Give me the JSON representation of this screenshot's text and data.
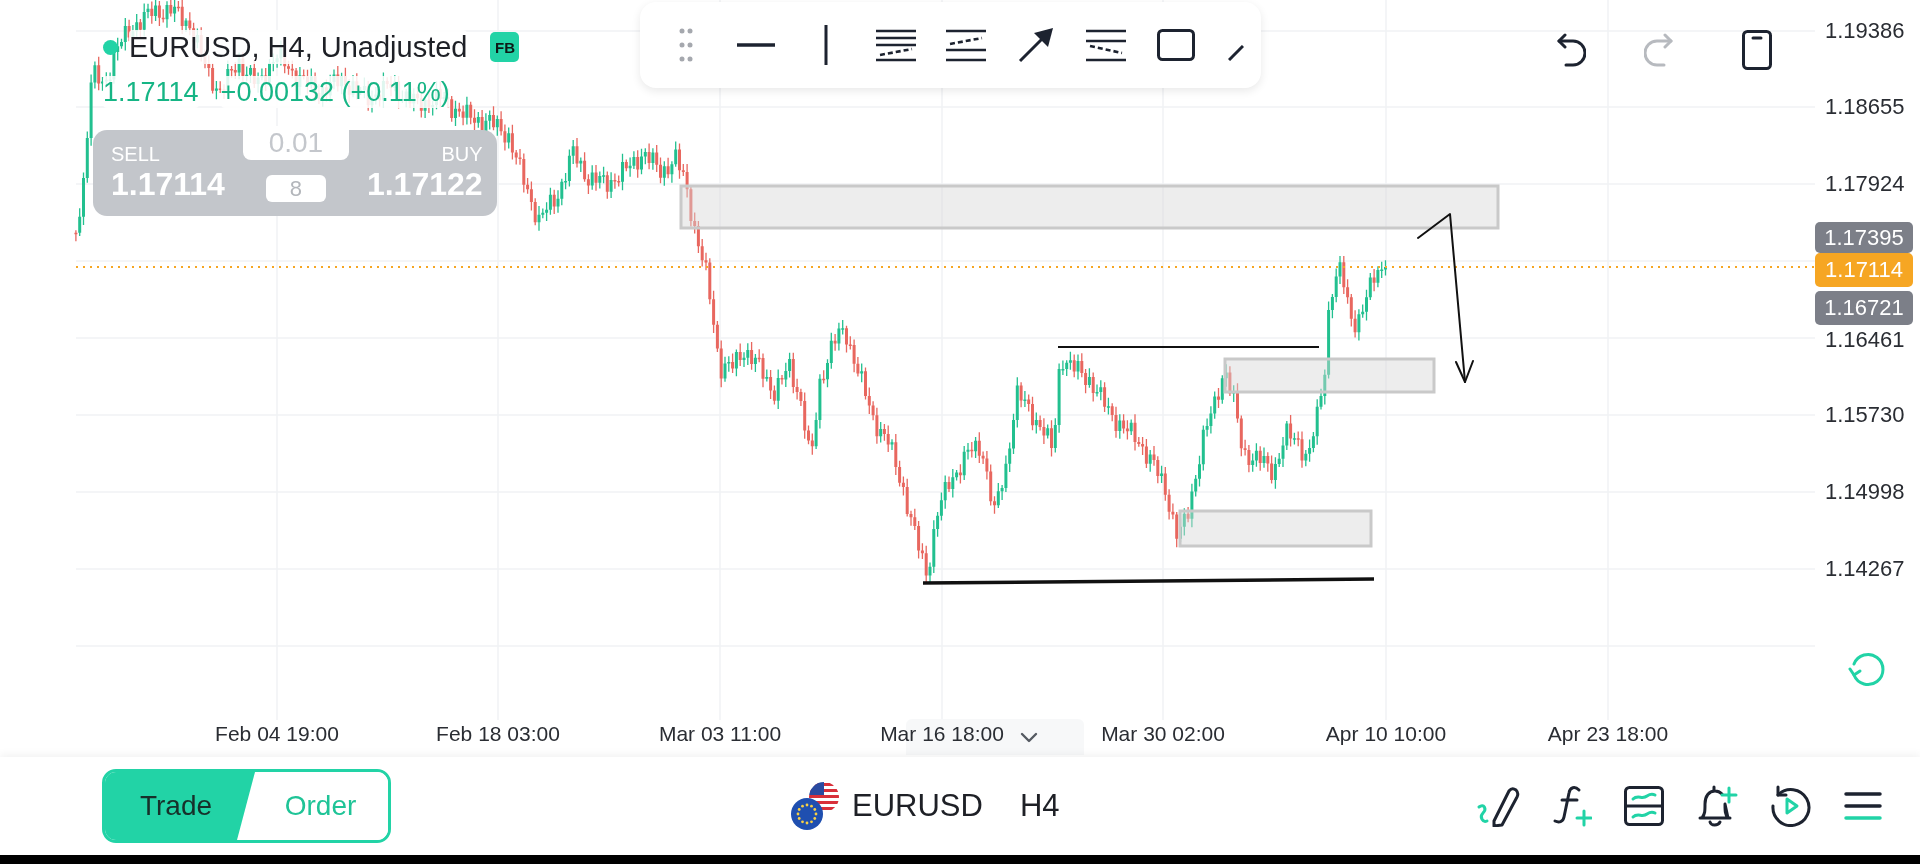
{
  "chart_header": {
    "title": "EURUSD, H4, Unadjusted",
    "badge": "FB",
    "price": "1.17114",
    "change": "+0.00132 (+0.11%)"
  },
  "order_panel": {
    "sell_label": "SELL",
    "sell_price": "1.17114",
    "volume": "0.01",
    "spread": "8",
    "buy_label": "BUY",
    "buy_price": "1.17122"
  },
  "history_buttons": [
    {
      "kind": "undo",
      "disabled": false
    },
    {
      "kind": "redo",
      "disabled": true
    }
  ],
  "price_axis": {
    "ticks": [
      "1.19386",
      "1.18655",
      "1.17924",
      "1.16461",
      "1.15730",
      "1.14998",
      "1.14267"
    ],
    "markers": [
      {
        "label": "1.17395",
        "color": "#7c7f88"
      },
      {
        "label": "1.17114",
        "color": "#f6a623"
      },
      {
        "label": "1.16721",
        "color": "#7c7f88"
      }
    ]
  },
  "time_axis": {
    "labels": [
      "Feb 04 19:00",
      "Feb 18 03:00",
      "Mar 03 11:00",
      "Mar 16 18:00",
      "Mar 30 02:00",
      "Apr 10 10:00",
      "Apr 23 18:00"
    ]
  },
  "bottom_bar": {
    "modes": [
      {
        "label": "Trade",
        "selected": true
      },
      {
        "label": "Order",
        "selected": false
      }
    ],
    "symbol": "EURUSD",
    "timeframe": "H4"
  }
}
